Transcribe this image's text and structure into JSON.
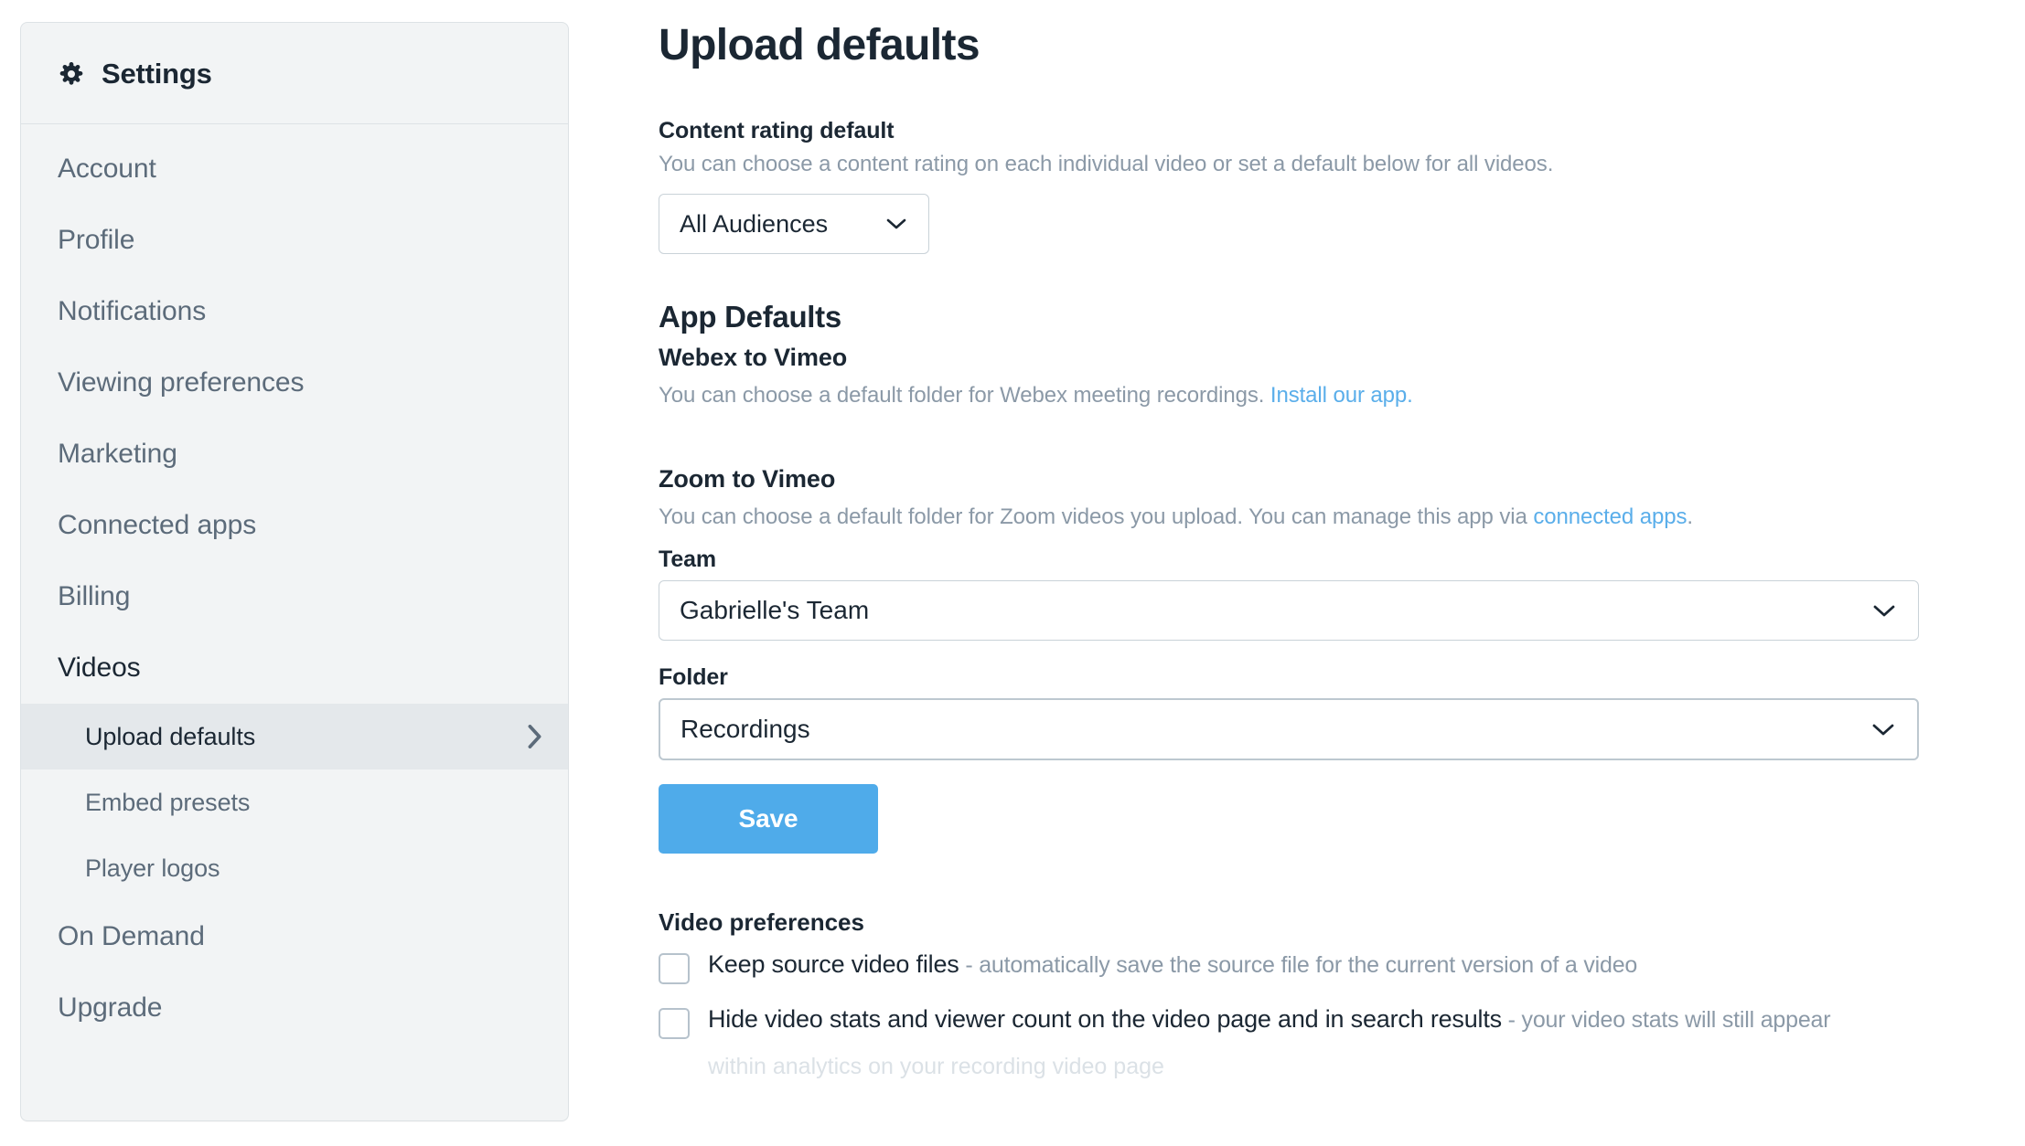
{
  "sidebar": {
    "header": {
      "title": "Settings",
      "icon": "gear-icon"
    },
    "items": [
      {
        "label": "Account",
        "type": "top",
        "state": "default"
      },
      {
        "label": "Profile",
        "type": "top",
        "state": "default"
      },
      {
        "label": "Notifications",
        "type": "top",
        "state": "default"
      },
      {
        "label": "Viewing preferences",
        "type": "top",
        "state": "default"
      },
      {
        "label": "Marketing",
        "type": "top",
        "state": "default"
      },
      {
        "label": "Connected apps",
        "type": "top",
        "state": "default"
      },
      {
        "label": "Billing",
        "type": "top",
        "state": "default"
      },
      {
        "label": "Videos",
        "type": "top",
        "state": "expanded"
      },
      {
        "label": "Upload defaults",
        "type": "sub",
        "state": "selected",
        "chevron": "chevron-right-icon"
      },
      {
        "label": "Embed presets",
        "type": "sub",
        "state": "default"
      },
      {
        "label": "Player logos",
        "type": "sub",
        "state": "default"
      },
      {
        "label": "On Demand",
        "type": "top",
        "state": "default"
      },
      {
        "label": "Upgrade",
        "type": "top",
        "state": "default"
      }
    ]
  },
  "main": {
    "page_title": "Upload defaults",
    "content_rating": {
      "label": "Content rating default",
      "description": "You can choose a content rating on each individual video or set a default below for all videos.",
      "selected": "All Audiences"
    },
    "app_defaults": {
      "section_title": "App Defaults",
      "webex": {
        "title": "Webex to Vimeo",
        "description_before": "You can choose a default folder for Webex meeting recordings. ",
        "link_text": "Install our app.",
        "description_after": ""
      },
      "zoom": {
        "title": "Zoom to Vimeo",
        "description_before": "You can choose a default folder for Zoom videos you upload. You can manage this app via ",
        "link_text": "connected apps",
        "description_after": ".",
        "team_label": "Team",
        "team_selected": "Gabrielle's Team",
        "folder_label": "Folder",
        "folder_selected": "Recordings",
        "save_label": "Save"
      }
    },
    "video_preferences": {
      "title": "Video preferences",
      "options": [
        {
          "label": "Keep source video files",
          "hint": " - automatically save the source file for the current version of a video",
          "checked": false
        },
        {
          "label": "Hide video stats and viewer count on the video page and in search results",
          "hint": " - your video stats will still appear",
          "hint_line2": "within analytics on your recording video page",
          "checked": false
        }
      ]
    }
  },
  "colors": {
    "accent_blue": "#4fabea",
    "link_blue": "#5aaeea",
    "text_dark": "#1b2733",
    "text_muted": "#8b99a7",
    "sidebar_bg": "#f2f4f5",
    "sidebar_selected": "#e4e8eb",
    "border": "#c9d2d8"
  }
}
